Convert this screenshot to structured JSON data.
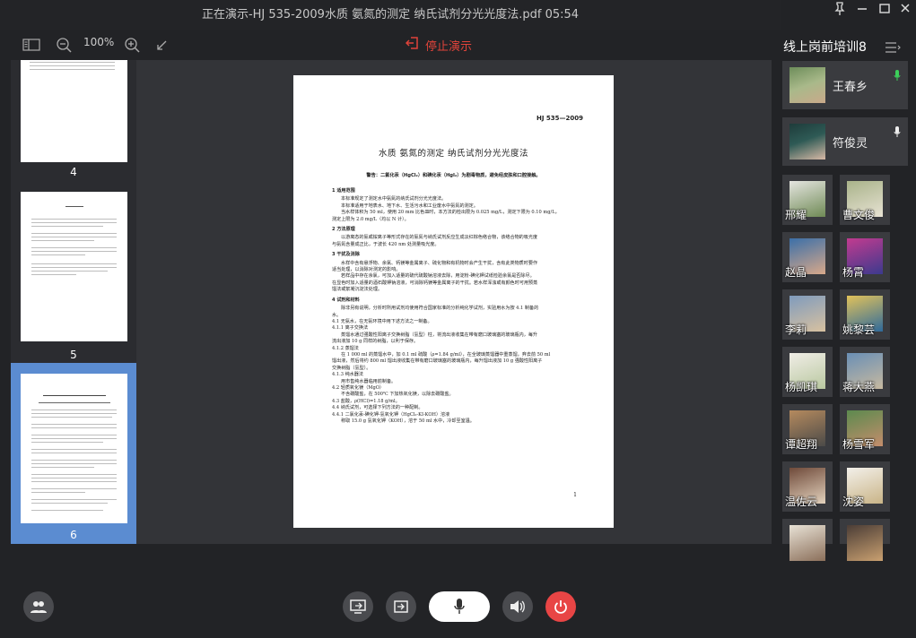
{
  "window": {
    "title": "正在演示-HJ 535-2009水质  氨氮的测定 纳氏试剂分光光度法.pdf 05:54",
    "controls": [
      "pin-icon",
      "minimize-icon",
      "maximize-icon",
      "close-icon"
    ]
  },
  "toolbar": {
    "zoom": "100%",
    "stop_label": "停止演示",
    "accent": "#e0433a"
  },
  "thumbnails": [
    {
      "page": "4",
      "active": false
    },
    {
      "page": "5",
      "active": false
    },
    {
      "page": "6",
      "active": true
    }
  ],
  "document": {
    "header": "HJ 535—2009",
    "title": "水质   氨氮的测定   纳氏试剂分光光度法",
    "warning": "警告：二氯化汞（HgCl₂）和碘化汞（HgI₂）为剧毒物质，避免经皮肤和口腔接触。",
    "lines": [
      {
        "t": "1   适用范围",
        "s": 1
      },
      {
        "t": "本标准规定了测定水中氨氮的纳氏试剂分光光度法。",
        "i": 1
      },
      {
        "t": "本标准适用于地表水、地下水、生活污水和工业废水中氨氮的测定。",
        "i": 1
      },
      {
        "t": "当水样体积为 50 ml，使用 20 mm 比色皿时，本方法的检出限为 0.025 mg/L，测定下限为 0.10 mg/L，",
        "i": 1
      },
      {
        "t": "测定上限为 2.0 mg/L（均以 N 计）。"
      },
      {
        "t": "2   方法原理",
        "s": 1
      },
      {
        "t": "以游离态的氨或铵离子等形式存在的氨氮与纳氏试剂反应生成淡红棕色络合物，该络合物的吸光度",
        "i": 1
      },
      {
        "t": "与氨氮含量成正比，于波长 420 nm 处测量吸光度。"
      },
      {
        "t": "3   干扰及消除",
        "s": 1
      },
      {
        "t": "水样中含有悬浮物、余氯、钙镁等金属离子、硫化物和有机物时会产生干扰，含有此类物质时要作",
        "i": 1
      },
      {
        "t": "适当处理，以消除对测定的影响。"
      },
      {
        "t": "若样品中存在余氯，可加入适量的硫代硫酸钠溶液去除，用淀粉-碘化钾试纸检验余氯是否除尽。",
        "i": 1
      },
      {
        "t": "在显色时加入适量的酒石酸钾钠溶液，可消除钙镁等金属离子的干扰。若水样浑浊或有颜色时可用预蒸"
      },
      {
        "t": "馏法或絮凝沉淀法处理。"
      },
      {
        "t": "4   试剂和材料",
        "s": 1
      },
      {
        "t": "除非另有说明，分析时所用试剂均使用符合国家标准的分析纯化学试剂，实验用水为按 4.1 制备的",
        "i": 1
      },
      {
        "t": "水。"
      },
      {
        "t": "4.1   无氨水，在无氨环境中用下述方法之一制备。"
      },
      {
        "t": "4.1.1   离子交换法"
      },
      {
        "t": "蒸馏水通过强酸性阳离子交换树脂（氢型）柱，将流出液收集在带有磨口玻璃塞的玻璃瓶内，每升",
        "i": 1
      },
      {
        "t": "流出液加 10 g 同样的树脂，以利于保存。"
      },
      {
        "t": "4.1.2   蒸馏法"
      },
      {
        "t": "在 1 000 ml 的蒸馏水中，加 0.1 ml 硫酸（ρ=1.84 g/ml），在全玻璃蒸馏器中重蒸馏，弃去前 50 ml",
        "i": 1
      },
      {
        "t": "馏出液，然后将约 800 ml 馏出液收集在带有磨口玻璃塞的玻璃瓶内，每升馏出液加 10 g 强酸性阳离子"
      },
      {
        "t": "交换树脂（氢型）。"
      },
      {
        "t": "4.1.3   纯水器法"
      },
      {
        "t": "用市售纯水器临用前制备。",
        "i": 1
      },
      {
        "t": "4.2   轻质氧化镁（MgO）"
      },
      {
        "t": "不含碳酸盐，在 500℃ 下加热氧化镁，以除去碳酸盐。",
        "i": 1
      },
      {
        "t": "4.3   盐酸，ρ(HCl)=1.18 g/ml。"
      },
      {
        "t": "4.4   纳氏试剂，可选择下列方法的一种配制。"
      },
      {
        "t": "4.4.1   二氯化汞-碘化钾-氢氧化钾（HgCl₂-KI-KOH）溶液"
      },
      {
        "t": "称取 15.0 g 氢氧化钾（KOH），溶于 50 ml 水中，冷却至室温。",
        "i": 1
      }
    ],
    "page_number": "1"
  },
  "sidebar": {
    "title": "线上岗前培训8",
    "presenters": [
      {
        "name": "王春乡",
        "mic": "green",
        "avatar": [
          "#6d8d5a",
          "#c9a98a"
        ]
      },
      {
        "name": "符俊灵",
        "mic": "white",
        "avatar": [
          "#1e3b3a",
          "#d7b9a6"
        ]
      }
    ],
    "participants": [
      {
        "name": "邢耀",
        "avatar": [
          "#e5e5e0",
          "#6f8a55"
        ]
      },
      {
        "name": "曹文俊",
        "avatar": [
          "#a9b38a",
          "#e7e2d3"
        ]
      },
      {
        "name": "赵晶",
        "avatar": [
          "#3b6fa8",
          "#d8a88a"
        ]
      },
      {
        "name": "杨霄",
        "avatar": [
          "#c23b8f",
          "#3c3a8e"
        ]
      },
      {
        "name": "李莉",
        "avatar": [
          "#7f9bbd",
          "#d8c1a0"
        ]
      },
      {
        "name": "姚黎芸",
        "avatar": [
          "#e2c25a",
          "#2f6a9b"
        ]
      },
      {
        "name": "杨凯琪",
        "avatar": [
          "#f0ede6",
          "#b9c8a0"
        ]
      },
      {
        "name": "蒋大燕",
        "avatar": [
          "#6a8fb5",
          "#c7b9a0"
        ]
      },
      {
        "name": "谭超翔",
        "avatar": [
          "#b58a5e",
          "#4b4a48"
        ]
      },
      {
        "name": "杨雪军",
        "avatar": [
          "#5c8a4e",
          "#c48d6c"
        ]
      },
      {
        "name": "温佐云",
        "avatar": [
          "#6f4a3a",
          "#e3d2bd"
        ]
      },
      {
        "name": "沈姿",
        "avatar": [
          "#f3f0ea",
          "#c9b487"
        ]
      },
      {
        "name": "",
        "avatar": [
          "#e8e2d6",
          "#8b6f5a"
        ]
      },
      {
        "name": "",
        "avatar": [
          "#4b3d36",
          "#c9a070"
        ]
      }
    ]
  },
  "controls": {
    "end_color": "#e84545"
  }
}
